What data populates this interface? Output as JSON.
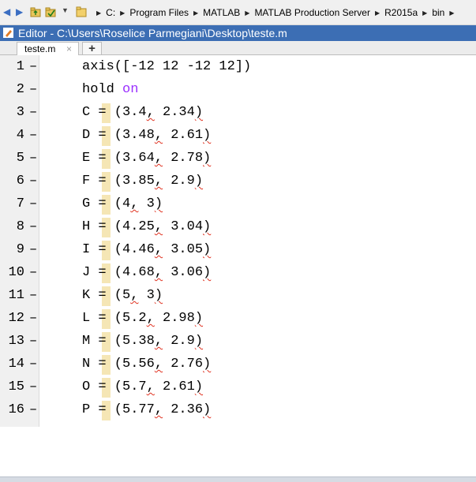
{
  "pathbar": {
    "crumbs": [
      "C:",
      "Program Files",
      "MATLAB",
      "MATLAB Production Server",
      "R2015a",
      "bin"
    ]
  },
  "title": "Editor - C:\\Users\\Roselice Parmegiani\\Desktop\\teste.m",
  "tabs": [
    {
      "label": "teste.m",
      "close": "×"
    }
  ],
  "new_tab_label": "+",
  "editor": {
    "lines": [
      {
        "num": "1",
        "dash": "–",
        "code": "axis([-12 12 -12 12])"
      },
      {
        "num": "2",
        "dash": "–",
        "keyword_prefix": "hold ",
        "keyword": "on"
      },
      {
        "num": "3",
        "dash": "–",
        "var": "C",
        "eq": "=",
        "x": "3.4",
        "y": "2.34"
      },
      {
        "num": "4",
        "dash": "–",
        "var": "D",
        "eq": "=",
        "x": "3.48",
        "y": "2.61"
      },
      {
        "num": "5",
        "dash": "–",
        "var": "E",
        "eq": "=",
        "x": "3.64",
        "y": "2.78"
      },
      {
        "num": "6",
        "dash": "–",
        "var": "F",
        "eq": "=",
        "x": "3.85",
        "y": "2.9"
      },
      {
        "num": "7",
        "dash": "–",
        "var": "G",
        "eq": "=",
        "x": "4",
        "y": "3"
      },
      {
        "num": "8",
        "dash": "–",
        "var": "H",
        "eq": "=",
        "x": "4.25",
        "y": "3.04"
      },
      {
        "num": "9",
        "dash": "–",
        "var": "I",
        "eq": "=",
        "x": "4.46",
        "y": "3.05"
      },
      {
        "num": "10",
        "dash": "–",
        "var": "J",
        "eq": "=",
        "x": "4.68",
        "y": "3.06"
      },
      {
        "num": "11",
        "dash": "–",
        "var": "K",
        "eq": "=",
        "x": "5",
        "y": "3"
      },
      {
        "num": "12",
        "dash": "–",
        "var": "L",
        "eq": "=",
        "x": "5.2",
        "y": "2.98"
      },
      {
        "num": "13",
        "dash": "–",
        "var": "M",
        "eq": "=",
        "x": "5.38",
        "y": "2.9"
      },
      {
        "num": "14",
        "dash": "–",
        "var": "N",
        "eq": "=",
        "x": "5.56",
        "y": "2.76"
      },
      {
        "num": "15",
        "dash": "–",
        "var": "O",
        "eq": "=",
        "x": "5.7",
        "y": "2.61"
      },
      {
        "num": "16",
        "dash": "–",
        "var": "P",
        "eq": "=",
        "x": "5.77",
        "y": "2.36"
      }
    ]
  },
  "colors": {
    "title_bar": "#3c6eb4",
    "keyword": "#9b30ff",
    "warning_underline": "#e0301e",
    "equals_highlight": "#f5e6b5"
  }
}
